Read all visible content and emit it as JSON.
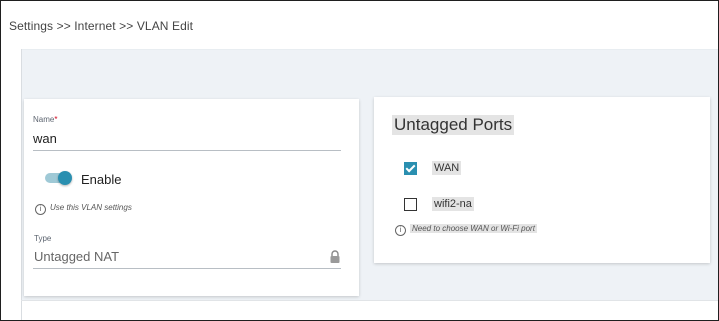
{
  "breadcrumb": "Settings >> Internet >> VLAN Edit",
  "vlan_form": {
    "name_label": "Name",
    "name_required": "*",
    "name_value": "wan",
    "enable_label": "Enable",
    "enable_on": true,
    "enable_hint": "Use this VLAN settings",
    "type_label": "Type",
    "type_value": "Untagged NAT"
  },
  "untagged_ports": {
    "title": "Untagged Ports",
    "ports": [
      {
        "label": "WAN",
        "checked": true
      },
      {
        "label": "wifi2-na",
        "checked": false
      }
    ],
    "hint": "Need to choose WAN or Wi-Fi port"
  },
  "colors": {
    "accent": "#2a8fb0",
    "page_background": "#eef2f6"
  },
  "icons": [
    "info-icon",
    "lock-icon",
    "check-icon"
  ]
}
